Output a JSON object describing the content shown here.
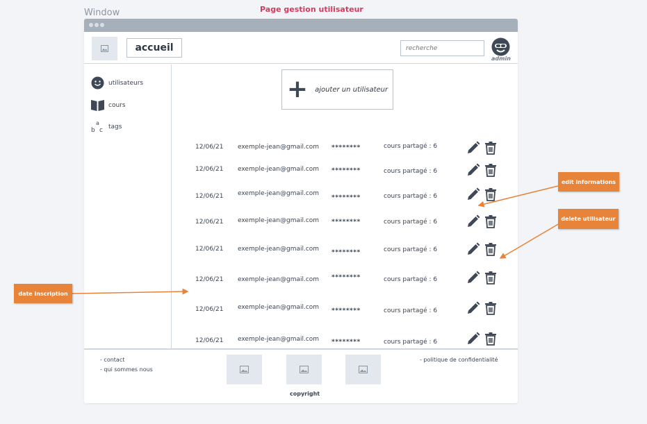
{
  "window_label": "Window",
  "page_title": "Page gestion utilisateur",
  "header": {
    "home_label": "accueil",
    "search_placeholder": "recherche",
    "user_label": "admin"
  },
  "sidebar": {
    "items": [
      {
        "label": "utilisateurs",
        "icon": "smiley-icon"
      },
      {
        "label": "cours",
        "icon": "book-icon"
      },
      {
        "label": "tags",
        "icon": "abc-tags-icon"
      }
    ]
  },
  "main": {
    "add_user_label": "ajouter un utilisateur",
    "users": [
      {
        "date": "12/06/21",
        "email": "exemple-jean@gmail.com",
        "password": "********",
        "shared": "cours partagé : 6"
      },
      {
        "date": "12/06/21",
        "email": "exemple-jean@gmail.com",
        "password": "********",
        "shared": "cours partagé : 6"
      },
      {
        "date": "12/06/21",
        "email": "exemple-jean@gmail.com",
        "password": "********",
        "shared": "cours partagé : 6"
      },
      {
        "date": "12/06/21",
        "email": "exemple-jean@gmail.com",
        "password": "********",
        "shared": "cours partagé : 6"
      },
      {
        "date": "12/06/21",
        "email": "exemple-jean@gmail.com",
        "password": "********",
        "shared": "cours partagé : 6"
      },
      {
        "date": "12/06/21",
        "email": "exemple-jean@gmail.com",
        "password": "********",
        "shared": "cours partagé : 6"
      },
      {
        "date": "12/06/21",
        "email": "exemple-jean@gmail.com",
        "password": "********",
        "shared": "cours partagé : 6"
      },
      {
        "date": "12/06/21",
        "email": "exemple-jean@gmail.com",
        "password": "********",
        "shared": "cours partagé : 6"
      }
    ]
  },
  "footer": {
    "links_left": [
      "- contact",
      "- qui sommes nous"
    ],
    "link_right": "- politique de confidentialité",
    "copyright": "copyright"
  },
  "annotations": {
    "edit": "edit informations",
    "delete": "delete utilisateur",
    "date": "date inscription"
  },
  "colors": {
    "accent_title": "#d33a5c",
    "callout": "#e8833a",
    "icon": "#3e4856"
  }
}
